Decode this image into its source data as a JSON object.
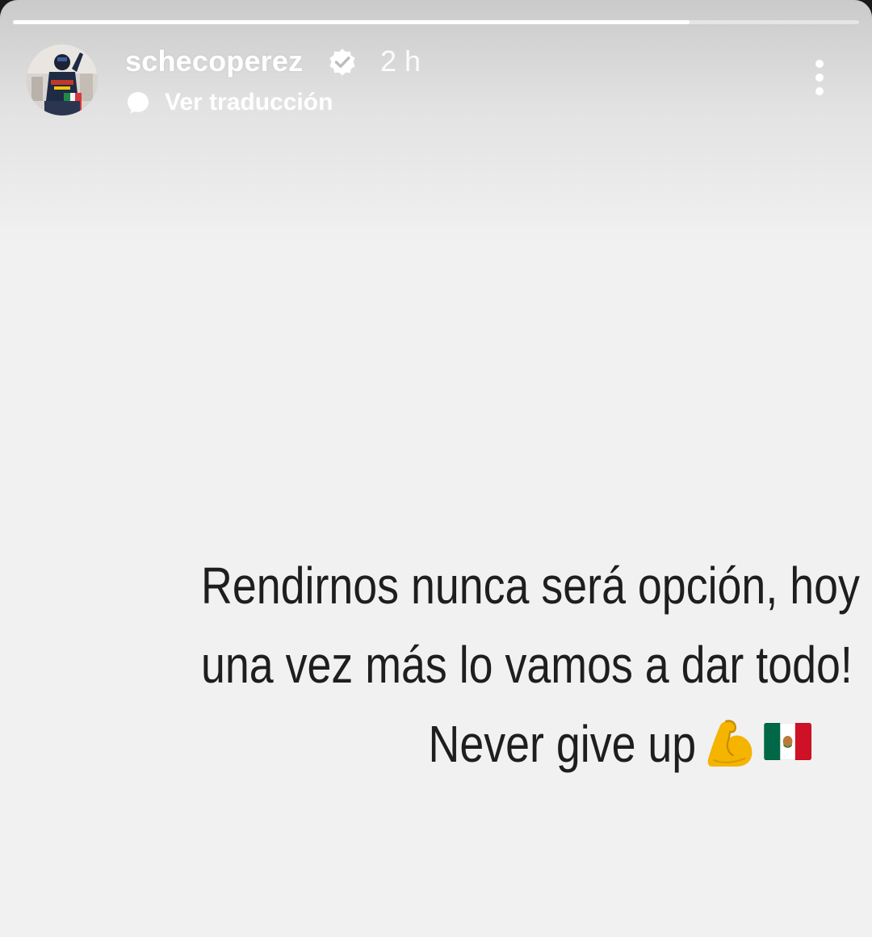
{
  "story": {
    "progress_percent": 80,
    "username": "schecoperez",
    "verified": true,
    "time_ago": "2 h",
    "translate_label": "Ver traducción",
    "icons": {
      "verified": "verified-badge-icon",
      "translate": "speech-bubble-icon",
      "menu": "more-vertical-icon"
    }
  },
  "caption": {
    "line1": "Rendirnos nunca será opción, hoy",
    "line2": "una vez más lo vamos a dar todo!",
    "line3": "Never give up",
    "emojis": [
      "flexed-biceps",
      "flag-mexico"
    ]
  },
  "colors": {
    "background": "#f1f1f1",
    "caption_text": "#1e1e1e",
    "overlay_text": "#ffffff"
  }
}
